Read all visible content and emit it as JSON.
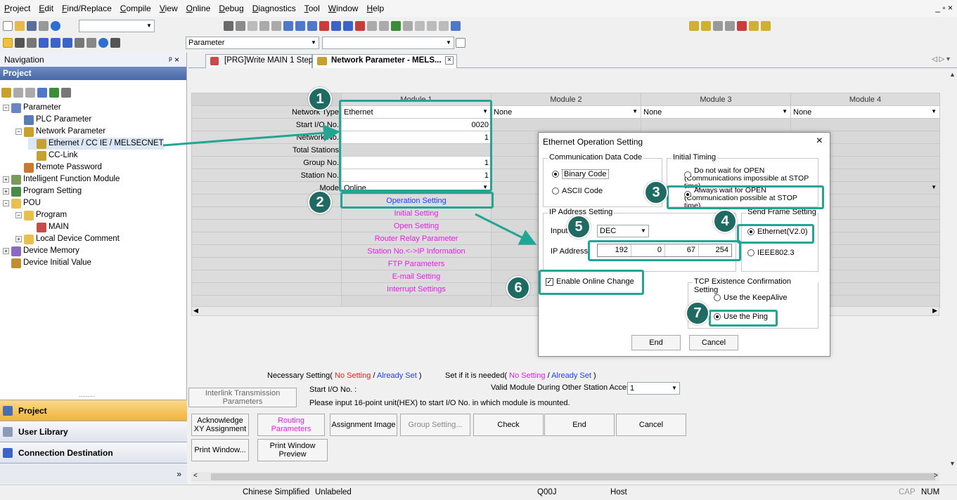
{
  "menu": [
    "Project",
    "Edit",
    "Find/Replace",
    "Compile",
    "View",
    "Online",
    "Debug",
    "Diagnostics",
    "Tool",
    "Window",
    "Help"
  ],
  "toolbar": {
    "combo_value": "Parameter"
  },
  "navigation": {
    "title": "Navigation",
    "pin_glyph": "ᵖ ×",
    "project_header": "Project",
    "tree": [
      {
        "label": "Parameter",
        "depth": 0,
        "icon": "parameter-icon"
      },
      {
        "label": "PLC Parameter",
        "depth": 1,
        "icon": "plc-parameter-icon"
      },
      {
        "label": "Network Parameter",
        "depth": 1,
        "icon": "network-parameter-icon"
      },
      {
        "label": "Ethernet / CC IE / MELSECNET",
        "depth": 2,
        "icon": "network-icon",
        "selected": true
      },
      {
        "label": "CC-Link",
        "depth": 2,
        "icon": "network-icon"
      },
      {
        "label": "Remote Password",
        "depth": 1,
        "icon": "password-icon"
      },
      {
        "label": "Intelligent Function Module",
        "depth": 0,
        "icon": "module-icon"
      },
      {
        "label": "Program Setting",
        "depth": 0,
        "icon": "program-setting-icon"
      },
      {
        "label": "POU",
        "depth": 0,
        "icon": "folder-icon"
      },
      {
        "label": "Program",
        "depth": 1,
        "icon": "folder-icon"
      },
      {
        "label": "MAIN",
        "depth": 2,
        "icon": "program-icon"
      },
      {
        "label": "Local Device Comment",
        "depth": 1,
        "icon": "folder-icon"
      },
      {
        "label": "Device Memory",
        "depth": 0,
        "icon": "device-memory-icon"
      },
      {
        "label": "Device Initial Value",
        "depth": 0,
        "icon": "device-initial-icon"
      }
    ],
    "bottom_buttons": [
      "Project",
      "User Library",
      "Connection Destination"
    ],
    "splitter_dots": "........."
  },
  "tabs": [
    {
      "label": "[PRG]Write MAIN 1 Step",
      "active": false
    },
    {
      "label": "Network Parameter - MELS...",
      "active": true
    }
  ],
  "grid": {
    "headers": [
      "Module 1",
      "Module 2",
      "Module 3",
      "Module 4"
    ],
    "rows": [
      {
        "label": "Network Type",
        "m1": "Ethernet",
        "m2": "None",
        "m3": "None",
        "m4": "None"
      },
      {
        "label": "Start I/O No.",
        "m1": "0020"
      },
      {
        "label": "Network No.",
        "m1": "1"
      },
      {
        "label": "Total Stations",
        "m1": ""
      },
      {
        "label": "Group No.",
        "m1": "1"
      },
      {
        "label": "Station No.",
        "m1": "1"
      },
      {
        "label": "Mode",
        "m1": "Online"
      }
    ],
    "links": [
      {
        "label": "Operation Setting",
        "color": "blue"
      },
      {
        "label": "Initial Setting",
        "color": "pink"
      },
      {
        "label": "Open Setting",
        "color": "pink"
      },
      {
        "label": "Router Relay Parameter",
        "color": "pink"
      },
      {
        "label": "Station No.<->IP Information",
        "color": "pink"
      },
      {
        "label": "FTP Parameters",
        "color": "pink"
      },
      {
        "label": "E-mail Setting",
        "color": "pink"
      },
      {
        "label": "Interrupt Settings",
        "color": "pink"
      }
    ]
  },
  "legend": {
    "necessary": "Necessary Setting(",
    "no_setting": "No Setting",
    "slash": "/",
    "already_set": "Already Set",
    "close": ")",
    "if_needed": "Set if it is needed(",
    "start_io": "Start I/O No. :",
    "valid_module": "Valid Module During Other Station Access",
    "valid_module_value": "1",
    "hint": "Please input 16-point unit(HEX) to start I/O No. in which module is mounted."
  },
  "bottom_buttons": {
    "interlink": "Interlink Transmission Parameters",
    "ack_xy": "Acknowledge XY Assignment",
    "routing": "Routing Parameters",
    "assignment_image": "Assignment Image",
    "group_setting": "Group Setting...",
    "check": "Check",
    "end": "End",
    "cancel": "Cancel",
    "print_window": "Print Window...",
    "print_preview": "Print Window Preview"
  },
  "dialog": {
    "title": "Ethernet Operation Setting",
    "close": "×",
    "comm_code_group": "Communication Data Code",
    "binary_code": "Binary Code",
    "ascii_code": "ASCII Code",
    "initial_timing_group": "Initial Timing",
    "no_wait": "Do not wait for OPEN (Communications impossible at STOP time)",
    "always_wait": "Always wait for OPEN (Communication possible at STOP time)",
    "ip_group": "IP Address Setting",
    "input_format_label": "Input",
    "input_format_value": "DEC",
    "ip_label": "IP Address",
    "ip": [
      "192",
      "0",
      "67",
      "254"
    ],
    "send_frame_group": "Send Frame Setting",
    "ethernet_v2": "Ethernet(V2.0)",
    "ieee": "IEEE802.3",
    "enable_online_change": "Enable Online Change",
    "tcp_group": "TCP Existence Confirmation Setting",
    "keepalive": "Use the KeepAlive",
    "ping": "Use the Ping",
    "end_button": "End",
    "cancel_button": "Cancel"
  },
  "callouts": [
    "1",
    "2",
    "3",
    "4",
    "5",
    "6",
    "7"
  ],
  "status": {
    "language": "Chinese Simplified",
    "label": "Unlabeled",
    "cpu": "Q00J",
    "host": "Host",
    "caps": "CAP",
    "num": "NUM"
  },
  "colors": {
    "callout": "#1f6b63",
    "highlight": "#22a592",
    "link_pink": "#e61ee6",
    "link_blue": "#1e3cff",
    "project_bar": "#4668a8",
    "active_nav": "#f6c14a"
  }
}
